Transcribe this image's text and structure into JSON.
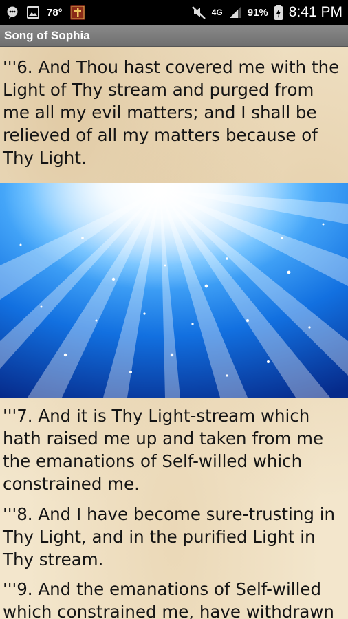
{
  "status_bar": {
    "temperature": "78°",
    "network": "4G",
    "battery": "91%",
    "time": "8:41 PM"
  },
  "app": {
    "title": "Song of Sophia"
  },
  "content": {
    "verse_6": "'''6. And Thou hast covered me with the Light of Thy stream and purged from me all my evil matters; and I shall be relieved of all my matters because of Thy Light.",
    "verse_7": "'''7. And it is Thy Light-stream which hath raised me up and taken from me the emanations of Self-willed which constrained me.",
    "verse_8": "'''8. And I have become sure-trusting in Thy Light, and in the purified Light in Thy stream.",
    "verse_9": "'''9. And the emanations of Self-willed which constrained me, have withdrawn"
  },
  "colors": {
    "status_bar": "#000000",
    "title_bar": "#7c7c7c",
    "parchment": "#f3e6cc",
    "text": "#151515",
    "light_blue": "#1a8cf0"
  },
  "icons": [
    "chat-bubble-icon",
    "picture-icon",
    "bible-app-icon",
    "mute-icon",
    "signal-icon",
    "battery-icon"
  ]
}
